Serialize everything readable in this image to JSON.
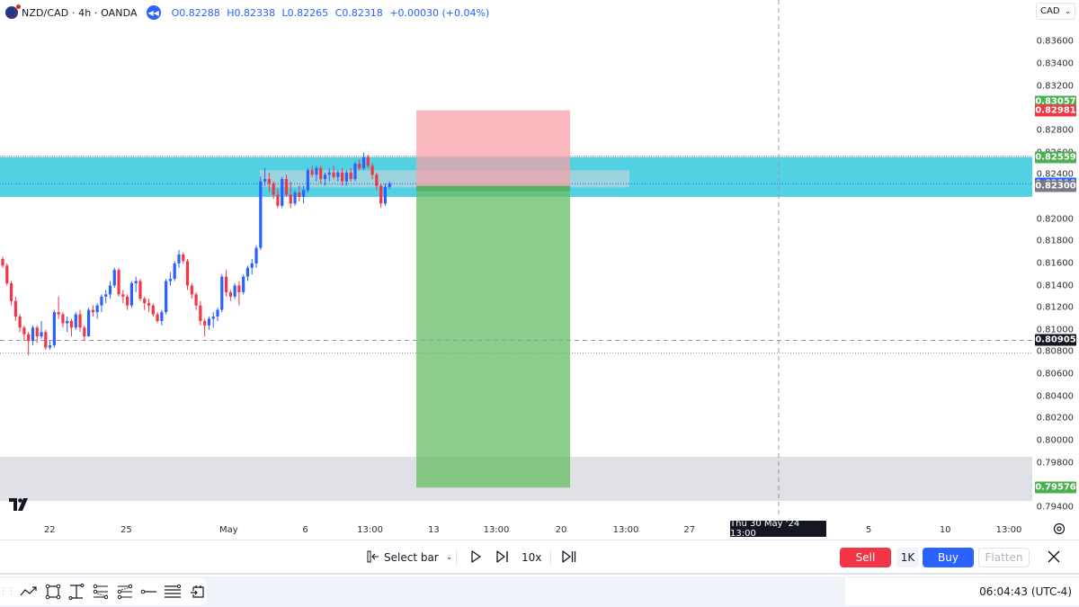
{
  "header": {
    "symbol": "NZD/CAD · 4h · OANDA",
    "ohlc": {
      "open": "O0.82288",
      "high": "H0.82338",
      "low": "L0.82265",
      "close": "C0.82318",
      "change": "+0.00030 (+0.04%)"
    },
    "rewind_icon": "rewind-icon"
  },
  "currency_select": {
    "value": "CAD",
    "icon": "chevron-down-icon"
  },
  "price_axis": {
    "ticks": [
      "0.83600",
      "0.83400",
      "0.83200",
      "0.82800",
      "0.82600",
      "0.82400",
      "0.82000",
      "0.81800",
      "0.81600",
      "0.81400",
      "0.81200",
      "0.81000",
      "0.80800",
      "0.80600",
      "0.80400",
      "0.80200",
      "0.80000",
      "0.79800",
      "0.79400"
    ],
    "tick_values": [
      0.836,
      0.834,
      0.832,
      0.828,
      0.826,
      0.824,
      0.82,
      0.818,
      0.816,
      0.814,
      0.812,
      0.81,
      0.808,
      0.806,
      0.804,
      0.802,
      0.8,
      0.798,
      0.794
    ],
    "range": [
      0.7931,
      0.83977
    ],
    "labels": [
      {
        "text": "0.83057",
        "value": 0.83057,
        "color": "#4caf50",
        "name": "target-price-label"
      },
      {
        "text": "0.82981",
        "value": 0.82981,
        "color": "#f23645",
        "name": "stop-price-label"
      },
      {
        "text": "0.82559",
        "value": 0.82559,
        "color": "#4caf50",
        "name": "zone-top-price-label"
      },
      {
        "text": "0.82318",
        "value": 0.82318,
        "color": "#2962ff",
        "name": "last-price-label"
      },
      {
        "text": "0.82300",
        "value": 0.823,
        "color": "#787b86",
        "name": "entry-price-label"
      },
      {
        "text": "0.80905",
        "value": 0.80905,
        "color": "#131722",
        "name": "crosshair-price-label"
      },
      {
        "text": "0.79576",
        "value": 0.79576,
        "color": "#4caf50",
        "name": "take-profit-price-label"
      }
    ]
  },
  "time_axis": {
    "ticks": [
      {
        "label": "22",
        "pos": 0.046
      },
      {
        "label": "25",
        "pos": 0.117
      },
      {
        "label": "May",
        "pos": 0.212
      },
      {
        "label": "6",
        "pos": 0.283
      },
      {
        "label": "13:00",
        "pos": 0.343
      },
      {
        "label": "13",
        "pos": 0.402
      },
      {
        "label": "13:00",
        "pos": 0.46
      },
      {
        "label": "20",
        "pos": 0.52
      },
      {
        "label": "13:00",
        "pos": 0.58
      },
      {
        "label": "27",
        "pos": 0.639
      },
      {
        "label": "5",
        "pos": 0.805
      },
      {
        "label": "10",
        "pos": 0.876
      },
      {
        "label": "13:00",
        "pos": 0.935
      }
    ],
    "crosshair_label": "Thu 30 May '24   13:00",
    "settings_icon": "settings-icon"
  },
  "chart_data": {
    "type": "candlestick",
    "title": "NZD/CAD · 4h · OANDA",
    "ylim": [
      0.7931,
      0.83977
    ],
    "up_color": "#2962ff",
    "down_color": "#f23645",
    "candles": [
      [
        0.8164,
        0.8166,
        0.8156,
        0.8158
      ],
      [
        0.8158,
        0.816,
        0.814,
        0.8142
      ],
      [
        0.8142,
        0.8144,
        0.8122,
        0.8126
      ],
      [
        0.8126,
        0.813,
        0.8108,
        0.8112
      ],
      [
        0.8112,
        0.8114,
        0.8098,
        0.8102
      ],
      [
        0.8102,
        0.8104,
        0.809,
        0.8096
      ],
      [
        0.8096,
        0.8098,
        0.8077,
        0.809
      ],
      [
        0.809,
        0.8104,
        0.8086,
        0.8102
      ],
      [
        0.8102,
        0.8104,
        0.8088,
        0.8094
      ],
      [
        0.8094,
        0.8108,
        0.8092,
        0.8098
      ],
      [
        0.8098,
        0.81,
        0.8082,
        0.8084
      ],
      [
        0.8084,
        0.809,
        0.8082,
        0.8086
      ],
      [
        0.8086,
        0.8118,
        0.8084,
        0.8116
      ],
      [
        0.8116,
        0.813,
        0.811,
        0.8114
      ],
      [
        0.8114,
        0.8116,
        0.8102,
        0.8106
      ],
      [
        0.8106,
        0.8112,
        0.8098,
        0.8108
      ],
      [
        0.8108,
        0.811,
        0.8094,
        0.8102
      ],
      [
        0.8102,
        0.8116,
        0.81,
        0.8114
      ],
      [
        0.8114,
        0.8118,
        0.8098,
        0.8102
      ],
      [
        0.8102,
        0.8104,
        0.809,
        0.8094
      ],
      [
        0.8094,
        0.812,
        0.8094,
        0.8118
      ],
      [
        0.8118,
        0.8122,
        0.8112,
        0.8116
      ],
      [
        0.8116,
        0.8124,
        0.811,
        0.8122
      ],
      [
        0.8122,
        0.8132,
        0.8116,
        0.813
      ],
      [
        0.813,
        0.8136,
        0.8124,
        0.8132
      ],
      [
        0.8132,
        0.8144,
        0.8128,
        0.814
      ],
      [
        0.814,
        0.8156,
        0.8138,
        0.8154
      ],
      [
        0.8154,
        0.8156,
        0.813,
        0.8132
      ],
      [
        0.8132,
        0.8136,
        0.8124,
        0.813
      ],
      [
        0.813,
        0.8132,
        0.8118,
        0.8122
      ],
      [
        0.8122,
        0.8144,
        0.812,
        0.8142
      ],
      [
        0.8142,
        0.8148,
        0.8134,
        0.8144
      ],
      [
        0.8144,
        0.8146,
        0.8126,
        0.8128
      ],
      [
        0.8128,
        0.813,
        0.8118,
        0.8124
      ],
      [
        0.8124,
        0.8128,
        0.8116,
        0.8122
      ],
      [
        0.8122,
        0.8124,
        0.8112,
        0.8114
      ],
      [
        0.8114,
        0.8116,
        0.8106,
        0.8108
      ],
      [
        0.8108,
        0.8118,
        0.8104,
        0.8116
      ],
      [
        0.8116,
        0.8146,
        0.8114,
        0.8144
      ],
      [
        0.8144,
        0.8152,
        0.814,
        0.8146
      ],
      [
        0.8146,
        0.8162,
        0.8144,
        0.816
      ],
      [
        0.816,
        0.8172,
        0.8156,
        0.8168
      ],
      [
        0.8168,
        0.817,
        0.816,
        0.8162
      ],
      [
        0.8162,
        0.8164,
        0.8136,
        0.814
      ],
      [
        0.814,
        0.8142,
        0.8128,
        0.8132
      ],
      [
        0.8132,
        0.8134,
        0.8118,
        0.8122
      ],
      [
        0.8122,
        0.8126,
        0.8104,
        0.8108
      ],
      [
        0.8108,
        0.811,
        0.8094,
        0.8104
      ],
      [
        0.8104,
        0.8112,
        0.81,
        0.811
      ],
      [
        0.811,
        0.8116,
        0.8102,
        0.8112
      ],
      [
        0.8112,
        0.812,
        0.8108,
        0.8118
      ],
      [
        0.8118,
        0.815,
        0.8116,
        0.8148
      ],
      [
        0.8148,
        0.8154,
        0.813,
        0.8134
      ],
      [
        0.8134,
        0.8136,
        0.8126,
        0.813
      ],
      [
        0.813,
        0.8142,
        0.8128,
        0.814
      ],
      [
        0.814,
        0.8144,
        0.8122,
        0.8134
      ],
      [
        0.8134,
        0.815,
        0.8132,
        0.8148
      ],
      [
        0.8148,
        0.8158,
        0.8144,
        0.8156
      ],
      [
        0.8156,
        0.8164,
        0.815,
        0.816
      ],
      [
        0.816,
        0.8176,
        0.8156,
        0.8174
      ],
      [
        0.8174,
        0.8238,
        0.8172,
        0.8234
      ],
      [
        0.8234,
        0.8246,
        0.823,
        0.8236
      ],
      [
        0.8236,
        0.8242,
        0.8224,
        0.8232
      ],
      [
        0.8232,
        0.8234,
        0.8218,
        0.8222
      ],
      [
        0.8222,
        0.8228,
        0.821,
        0.8212
      ],
      [
        0.8212,
        0.8238,
        0.821,
        0.8236
      ],
      [
        0.8236,
        0.824,
        0.822,
        0.8222
      ],
      [
        0.8222,
        0.8234,
        0.821,
        0.8214
      ],
      [
        0.8214,
        0.8226,
        0.8212,
        0.8224
      ],
      [
        0.8224,
        0.823,
        0.8216,
        0.822
      ],
      [
        0.822,
        0.823,
        0.8214,
        0.8226
      ],
      [
        0.8226,
        0.8246,
        0.8224,
        0.8244
      ],
      [
        0.8244,
        0.8248,
        0.8238,
        0.824
      ],
      [
        0.824,
        0.8248,
        0.8234,
        0.8246
      ],
      [
        0.8246,
        0.8248,
        0.8232,
        0.8236
      ],
      [
        0.8236,
        0.8242,
        0.823,
        0.824
      ],
      [
        0.824,
        0.8246,
        0.8234,
        0.8242
      ],
      [
        0.8242,
        0.8248,
        0.8236,
        0.8238
      ],
      [
        0.8238,
        0.8244,
        0.8234,
        0.8242
      ],
      [
        0.8242,
        0.8246,
        0.823,
        0.8234
      ],
      [
        0.8234,
        0.8244,
        0.823,
        0.8242
      ],
      [
        0.8242,
        0.8246,
        0.8234,
        0.8236
      ],
      [
        0.8236,
        0.8252,
        0.8234,
        0.825
      ],
      [
        0.825,
        0.8254,
        0.8244,
        0.8246
      ],
      [
        0.8246,
        0.826,
        0.8244,
        0.8256
      ],
      [
        0.8256,
        0.8258,
        0.8246,
        0.8248
      ],
      [
        0.8248,
        0.825,
        0.8236,
        0.824
      ],
      [
        0.824,
        0.8242,
        0.8226,
        0.823
      ],
      [
        0.823,
        0.8232,
        0.821,
        0.8214
      ],
      [
        0.8214,
        0.8232,
        0.8212,
        0.8229
      ],
      [
        0.8229,
        0.8234,
        0.8227,
        0.8232
      ]
    ]
  },
  "drawings": {
    "resistance_zone": {
      "top": 0.82559,
      "bottom": 0.822,
      "color": "#26c6da"
    },
    "inner_zone": {
      "top": 0.8244,
      "bottom": 0.82286,
      "color": "#d1d4dc"
    },
    "support_zone": {
      "top": 0.79855,
      "bottom": 0.79455,
      "color": "#d1d4dc"
    },
    "short_position": {
      "stop": 0.82981,
      "entry": 0.823,
      "target": 0.79576,
      "risk_color": "#f7a1aa",
      "reward_color": "#6abf69"
    },
    "crosshair_price": 0.80905,
    "last_price": 0.82318,
    "low_marker": 0.8079
  },
  "replay_bar": {
    "select_bar": "Select bar",
    "speed": "10x",
    "icons": [
      "select-bar-icon",
      "chevron-down-icon",
      "play-icon",
      "step-forward-icon",
      "jump-to-realtime-icon"
    ]
  },
  "trade": {
    "sell": "Sell",
    "quantity": "1K",
    "buy": "Buy",
    "flatten": "Flatten",
    "close_icon": "close-icon"
  },
  "footer": {
    "clock": "06:04:43 (UTC-4)",
    "drawing_tools": [
      "trend-line-icon",
      "rectangle-icon",
      "price-range-icon",
      "long-position-icon",
      "short-position-icon",
      "horizontal-line-icon",
      "horizontal-lines-icon",
      "date-range-icon"
    ]
  }
}
